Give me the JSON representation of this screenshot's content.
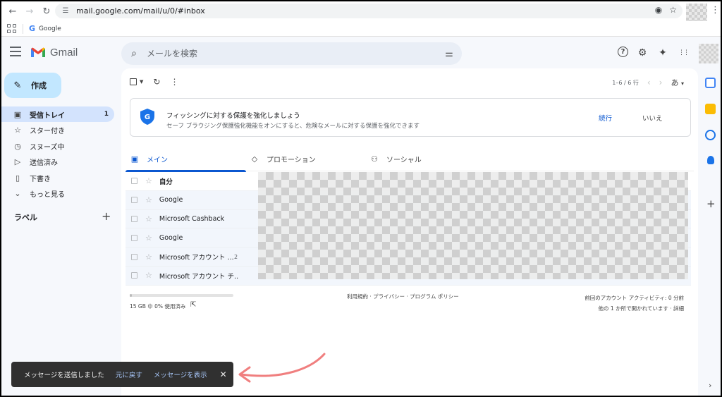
{
  "browser": {
    "url": "mail.google.com/mail/u/0/#inbox",
    "bookmark_label": "Google",
    "back_icon": "←",
    "forward_icon": "→",
    "reload_icon": "↻",
    "eye_icon": "◉",
    "star_icon": "☆",
    "menu_icon": "⋮",
    "tune_icon": "☰",
    "google_letter": "G"
  },
  "header": {
    "app_name": "Gmail",
    "search_placeholder": "メールを検索",
    "search_icon": "⌕",
    "filter_icon": "⚌",
    "help_icon": "?",
    "settings_icon": "⚙",
    "gemini_icon": "✦",
    "apps_icon": "⋮⋮"
  },
  "nav": {
    "compose_label": "作成",
    "compose_icon": "✎",
    "items": [
      {
        "label": "受信トレイ",
        "count": "1",
        "icon": "▣"
      },
      {
        "label": "スター付き",
        "count": "",
        "icon": "☆"
      },
      {
        "label": "スヌーズ中",
        "count": "",
        "icon": "◷"
      },
      {
        "label": "送信済み",
        "count": "",
        "icon": "▷"
      },
      {
        "label": "下書き",
        "count": "",
        "icon": "▯"
      },
      {
        "label": "もっと見る",
        "count": "",
        "icon": "⌄"
      }
    ],
    "labels_heading": "ラベル",
    "labels_add": "+"
  },
  "toolbar": {
    "select_caret": "▼",
    "refresh_icon": "↻",
    "more_icon": "⋮",
    "range": "1–6 / 6 行",
    "prev_icon": "‹",
    "next_icon": "›",
    "ime": "あ",
    "ime_caret": "▾"
  },
  "banner": {
    "title": "フィッシングに対する保護を強化しましょう",
    "description": "セーフ ブラウジング保護強化機能をオンにすると、危険なメールに対する保護を強化できます",
    "accept": "続行",
    "decline": "いいえ",
    "shield_letter": "G"
  },
  "tabs": [
    {
      "label": "メイン",
      "icon": "▣",
      "active": true
    },
    {
      "label": "プロモーション",
      "icon": "◇",
      "active": false
    },
    {
      "label": "ソーシャル",
      "icon": "⚇",
      "active": false
    }
  ],
  "mails": [
    {
      "sender": "自分",
      "count": "",
      "unread": true
    },
    {
      "sender": "Google",
      "count": "",
      "unread": false
    },
    {
      "sender": "Microsoft Cashback",
      "count": "",
      "unread": false
    },
    {
      "sender": "Google",
      "count": "",
      "unread": false
    },
    {
      "sender": "Microsoft アカウント ...",
      "count": "2",
      "unread": false
    },
    {
      "sender": "Microsoft アカウント チ...",
      "count": "",
      "unread": false
    }
  ],
  "footer": {
    "storage": "15 GB 中 0% 使用済み",
    "storage_fraction": 0.02,
    "open_icon": "⇱",
    "policy": "利用規約 · プライバシー · プログラム ポリシー",
    "activity_line1": "前回のアカウント アクティビティ: 0 分前",
    "activity_line2": "他の 1 か所で開かれています · 詳細"
  },
  "side_panel": {
    "add_icon": "+",
    "expand_icon": "›"
  },
  "snackbar": {
    "message": "メッセージを送信しました",
    "undo": "元に戻す",
    "view": "メッセージを表示",
    "close_icon": "✕"
  },
  "colors": {
    "accent": "#0b57d0",
    "compose_bg": "#c2e7ff",
    "active_nav_bg": "#d3e3fd",
    "snackbar_bg": "#303030",
    "annotation_arrow": "#f07f7f"
  }
}
